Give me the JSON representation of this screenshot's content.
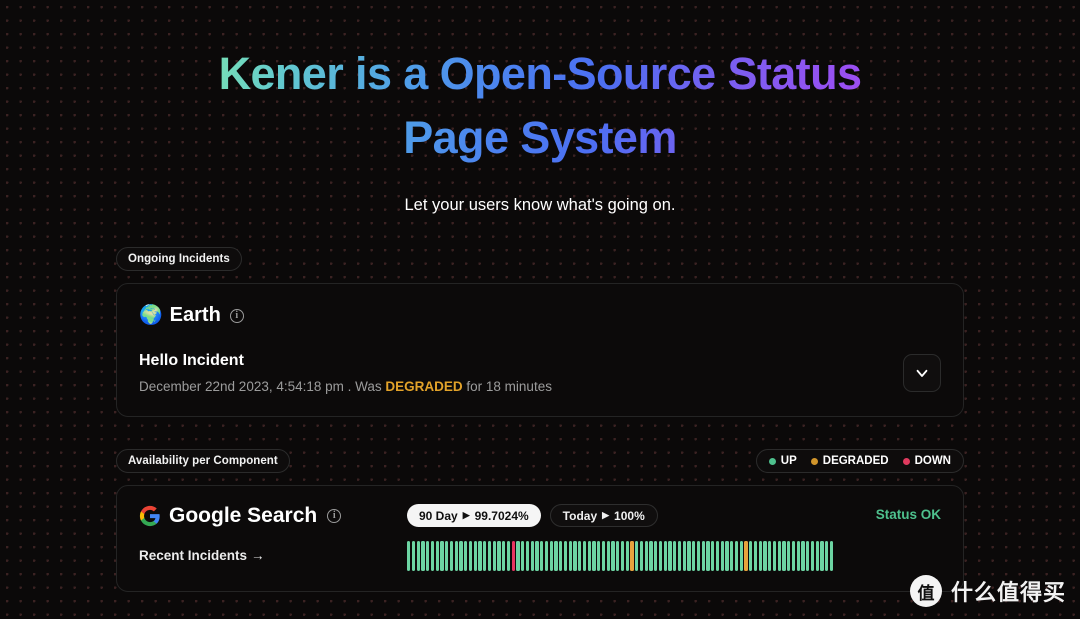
{
  "hero": {
    "title": "Kener is a Open-Source Status Page System",
    "subtitle": "Let your users know what's going on."
  },
  "ongoing": {
    "section_label": "Ongoing Incidents",
    "component_name": "Earth",
    "component_emoji": "earth-globe-emoji",
    "incident_title": "Hello Incident",
    "meta_prefix": "December 22nd 2023, 4:54:18 pm . Was ",
    "meta_status": "DEGRADED",
    "meta_suffix": " for 18 minutes",
    "expand_icon": "chevron-down-icon"
  },
  "availability": {
    "section_label": "Availability per Component",
    "legend": [
      {
        "label": "UP",
        "color": "#4ec08d"
      },
      {
        "label": "DEGRADED",
        "color": "#d1952b"
      },
      {
        "label": "DOWN",
        "color": "#e03a5e"
      }
    ],
    "component": {
      "name": "Google Search",
      "logo": "google-g-icon",
      "recent_incidents_label": "Recent Incidents",
      "recent_incidents_arrow": "→",
      "badges": [
        {
          "label": "90 Day",
          "sep": "▶",
          "value": "99.7024%",
          "style": "light"
        },
        {
          "label": "Today",
          "sep": "▶",
          "value": "100%",
          "style": "dark"
        }
      ],
      "status_text": "Status OK",
      "status_color": "#4ec08d"
    }
  },
  "chart_data": {
    "type": "bar",
    "title": "90 day uptime — Google Search",
    "xlabel": "",
    "ylabel": "",
    "bar_count": 90,
    "colors": {
      "UP": "#6dd5a3",
      "DEGRADED": "#e8a33d",
      "DOWN": "#e8355f"
    },
    "statuses": [
      "UP",
      "UP",
      "UP",
      "UP",
      "UP",
      "UP",
      "UP",
      "UP",
      "UP",
      "UP",
      "UP",
      "UP",
      "UP",
      "UP",
      "UP",
      "UP",
      "UP",
      "UP",
      "UP",
      "UP",
      "UP",
      "UP",
      "DOWN",
      "UP",
      "UP",
      "UP",
      "UP",
      "UP",
      "UP",
      "UP",
      "UP",
      "UP",
      "UP",
      "UP",
      "UP",
      "UP",
      "UP",
      "UP",
      "UP",
      "UP",
      "UP",
      "UP",
      "UP",
      "UP",
      "UP",
      "UP",
      "UP",
      "DEGRADED",
      "UP",
      "UP",
      "UP",
      "UP",
      "UP",
      "UP",
      "UP",
      "UP",
      "UP",
      "UP",
      "UP",
      "UP",
      "UP",
      "UP",
      "UP",
      "UP",
      "UP",
      "UP",
      "UP",
      "UP",
      "UP",
      "UP",
      "UP",
      "DEGRADED",
      "UP",
      "UP",
      "UP",
      "UP",
      "UP",
      "UP",
      "UP",
      "UP",
      "UP",
      "UP",
      "UP",
      "UP",
      "UP",
      "UP",
      "UP",
      "UP",
      "UP",
      "UP"
    ]
  },
  "watermark": {
    "badge": "值",
    "text": "什么值得买"
  }
}
